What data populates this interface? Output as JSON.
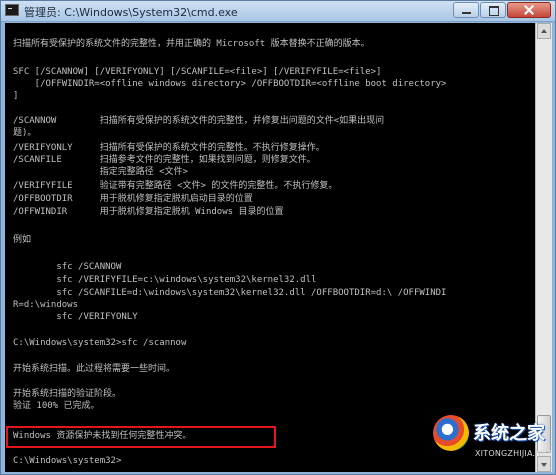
{
  "window": {
    "title": "管理员: C:\\Windows\\System32\\cmd.exe"
  },
  "console": {
    "lines": [
      "扫描所有受保护的系统文件的完整性，并用正确的 Microsoft 版本替换不正确的版本。",
      "SFC [/SCANNOW] [/VERIFYONLY] [/SCANFILE=<file>] [/VERIFYFILE=<file>]",
      "    [/OFFWINDIR=<offline windows directory> /OFFBOOTDIR=<offline boot directory>",
      "]",
      "/SCANNOW        扫描所有受保护的系统文件的完整性，并修复出问题的文件<如果出现问",
      "题)。",
      "/VERIFYONLY     扫描所有受保护的系统文件的完整性。不执行修复操作。",
      "/SCANFILE       扫描参考文件的完整性，如果找到问题，则修复文件。",
      "                指定完整路径 <文件>",
      "/VERIFYFILE     验证带有完整路径 <文件> 的文件的完整性。不执行修复。",
      "/OFFBOOTDIR     用于脱机修复指定脱机启动目录的位置",
      "/OFFWINDIR      用于脱机修复指定脱机 Windows 目录的位置",
      "例如",
      "        sfc /SCANNOW",
      "        sfc /VERIFYFILE=c:\\windows\\system32\\kernel32.dll",
      "        sfc /SCANFILE=d:\\windows\\system32\\kernel32.dll /OFFBOOTDIR=d:\\ /OFFWINDI",
      "R=d:\\windows",
      "        sfc /VERIFYONLY",
      "C:\\Windows\\system32>sfc /scannow",
      "开始系统扫描。此过程将需要一些时间。",
      "开始系统扫描的验证阶段。",
      "验证 100% 已完成。",
      "Windows 资源保护未找到任何完整性冲突。",
      "C:\\Windows\\system32>"
    ]
  },
  "watermark": {
    "brand": "系统之家",
    "url": "XITONGZHIJIA.NET"
  }
}
